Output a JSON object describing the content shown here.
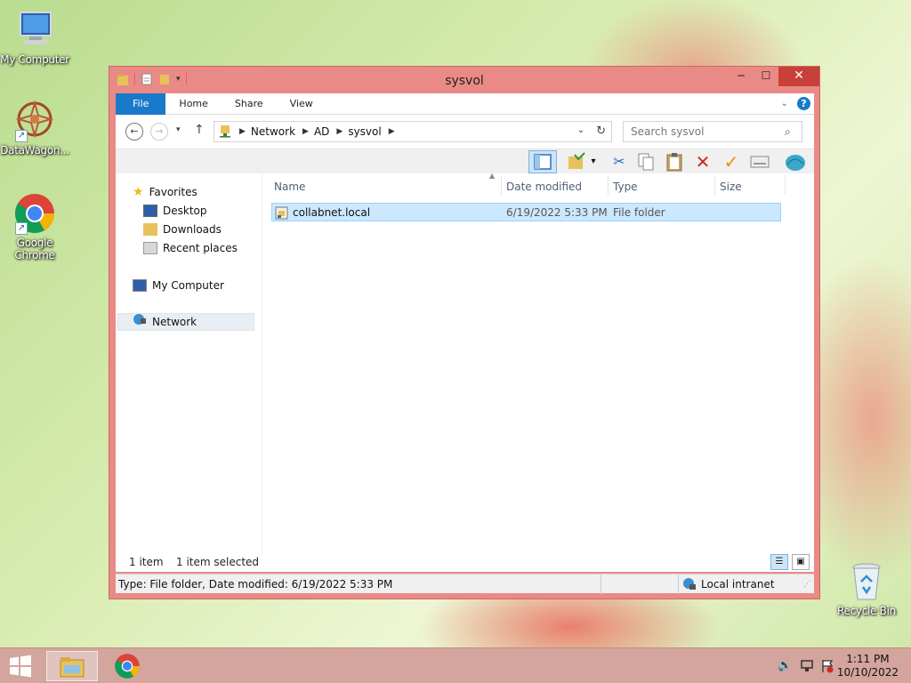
{
  "desktop": {
    "icons": [
      {
        "label": "My Computer"
      },
      {
        "label": "DataWagon..."
      },
      {
        "label": "Google Chrome"
      },
      {
        "label": "Recycle Bin"
      }
    ]
  },
  "window": {
    "title": "sysvol",
    "ribbon_tabs": [
      "File",
      "Home",
      "Share",
      "View"
    ],
    "address": {
      "crumbs": [
        "Network",
        "AD",
        "sysvol"
      ]
    },
    "search": {
      "placeholder": "Search sysvol"
    },
    "nav_pane": {
      "favorites": "Favorites",
      "desktop": "Desktop",
      "downloads": "Downloads",
      "recent": "Recent places",
      "my_computer": "My Computer",
      "network": "Network"
    },
    "columns": [
      "Name",
      "Date modified",
      "Type",
      "Size"
    ],
    "rows": [
      {
        "name": "collabnet.local",
        "date": "6/19/2022 5:33 PM",
        "type": "File folder",
        "size": ""
      }
    ],
    "status": {
      "item_count": "1 item",
      "selected": "1 item selected",
      "details": "Type: File folder, Date modified: 6/19/2022 5:33 PM",
      "zone": "Local intranet"
    }
  },
  "taskbar": {
    "time": "1:11 PM",
    "date": "10/10/2022"
  },
  "colors": {
    "window_frame": "#ea8a86",
    "close_button": "#c7413a",
    "file_tab": "#1979ca",
    "selection": "#cce8ff"
  }
}
